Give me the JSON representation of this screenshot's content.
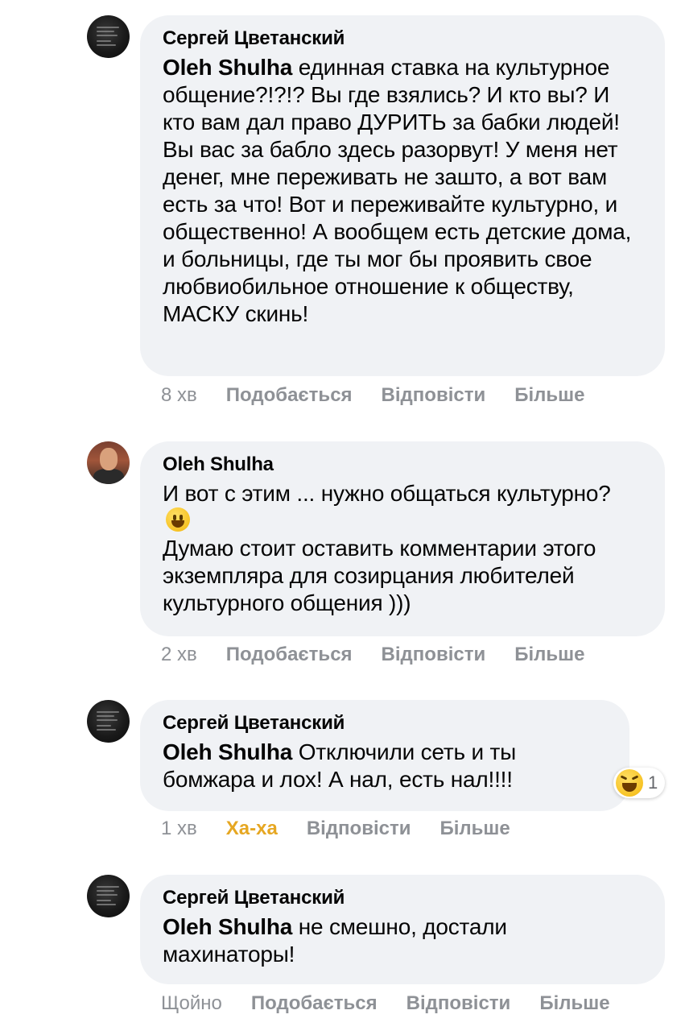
{
  "comments": [
    {
      "author": "Сергей Цветанский",
      "mention": "Oleh Shulha",
      "text": " единная ставка на культурное общение?!?!? Вы где взялись? И кто вы? И кто вам дал право ДУРИТЬ за бабки людей! Вы вас за бабло здесь разорвут! У меня нет денег, мне переживать не зашто, а вот вам есть за что! Вот и переживайте культурно, и общественно! А вообщем есть детские дома, и больницы, где ты мог бы проявить свое любвиобильное отношение к обществу, МАСКУ скинь!",
      "time": "8 хв",
      "like_label": "Подобається",
      "reply_label": "Відповісти",
      "more_label": "Більше"
    },
    {
      "author": "Oleh Shulha",
      "text_line1": "И вот с этим ... нужно общаться культурно? ",
      "emoji_icon": "grinning-face-emoji",
      "text_line2": "Думаю стоит оставить комментарии этого экземпляра для созирцания любителей культурного общения )))",
      "time": "2 хв",
      "like_label": "Подобається",
      "reply_label": "Відповісти",
      "more_label": "Більше"
    },
    {
      "author": "Сергей Цветанский",
      "mention": "Oleh Shulha",
      "text": " Отключили сеть и ты бомжара и лох! А нал, есть нал!!!!",
      "time": "1 хв",
      "like_label": "Ха-ха",
      "reply_label": "Відповісти",
      "more_label": "Більше",
      "reaction_icon": "laughing-face-emoji",
      "reaction_count": "1"
    },
    {
      "author": "Сергей Цветанский",
      "mention": "Oleh Shulha",
      "text": " не смешно, достали махинаторы!",
      "time": "Щойно",
      "like_label": "Подобається",
      "reply_label": "Відповісти",
      "more_label": "Більше"
    }
  ],
  "colors": {
    "bubble": "#f0f2f5",
    "meta_text": "#8e9196",
    "haha": "#e6a722"
  }
}
